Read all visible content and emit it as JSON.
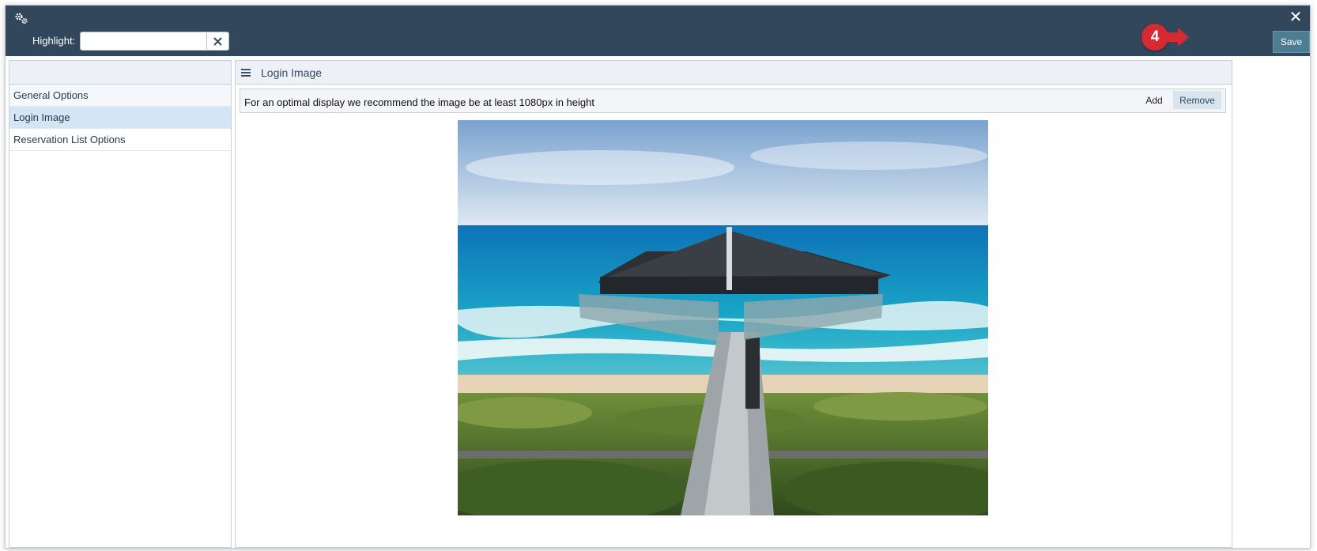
{
  "header": {
    "highlight_label": "Highlight:",
    "highlight_value": "",
    "save_label": "Save",
    "step_number": "4"
  },
  "sidebar": {
    "items": [
      {
        "label": "General Options"
      },
      {
        "label": "Login Image"
      },
      {
        "label": "Reservation List Options"
      }
    ],
    "selected": "Login Image"
  },
  "panel": {
    "title": "Login Image",
    "notice": "For an optimal display we recommend the image be at least 1080px in height",
    "add_label": "Add",
    "remove_label": "Remove"
  },
  "colors": {
    "titlebar": "#33475c",
    "save_button": "#4e7c92",
    "step_badge": "#d42a30",
    "selected_item": "#d2e6f6"
  },
  "icons": {
    "settings": "gear-icon",
    "close": "close-icon",
    "clear": "clear-x-icon",
    "menu": "hamburger-menu-icon"
  }
}
